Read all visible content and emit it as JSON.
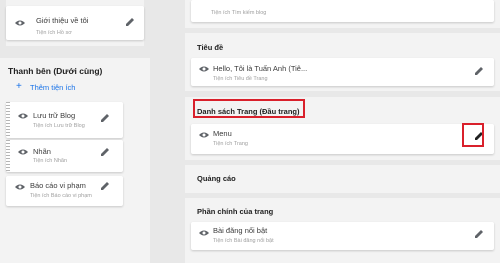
{
  "sidebar": {
    "top_widget": {
      "title": "Giới thiệu về tôi",
      "subtitle": "Tiện ích Hồ sơ"
    },
    "section_title": "Thanh bên (Dưới cùng)",
    "add_gadget": "Thêm tiện ích",
    "widgets": [
      {
        "title": "Lưu trữ Blog",
        "subtitle": "Tiện ích Lưu trữ Blog"
      },
      {
        "title": "Nhãn",
        "subtitle": "Tiện ích Nhãn"
      },
      {
        "title": "Báo cáo vi phạm",
        "subtitle": "Tiện ích Báo cáo vi phạm"
      }
    ]
  },
  "main": {
    "top_widget_subtitle": "Tiện ích Tìm kiếm blog",
    "sections": [
      {
        "title": "Tiêu đề",
        "widget_title": "Hello, Tôi là Tuấn Anh (Tiê...",
        "widget_subtitle": "Tiện ích Tiêu đề Trang"
      },
      {
        "title": "Danh sách Trang (Đầu trang)",
        "widget_title": "Menu",
        "widget_subtitle": "Tiện ích Trang"
      },
      {
        "title": "Quảng cáo"
      },
      {
        "title": "Phần chính của trang",
        "widget_title": "Bài đăng nổi bật",
        "widget_subtitle": "Tiện ích Bài đăng nổi bật"
      }
    ]
  },
  "colors": {
    "highlight": "#d9202b",
    "link": "#1a73e8"
  }
}
